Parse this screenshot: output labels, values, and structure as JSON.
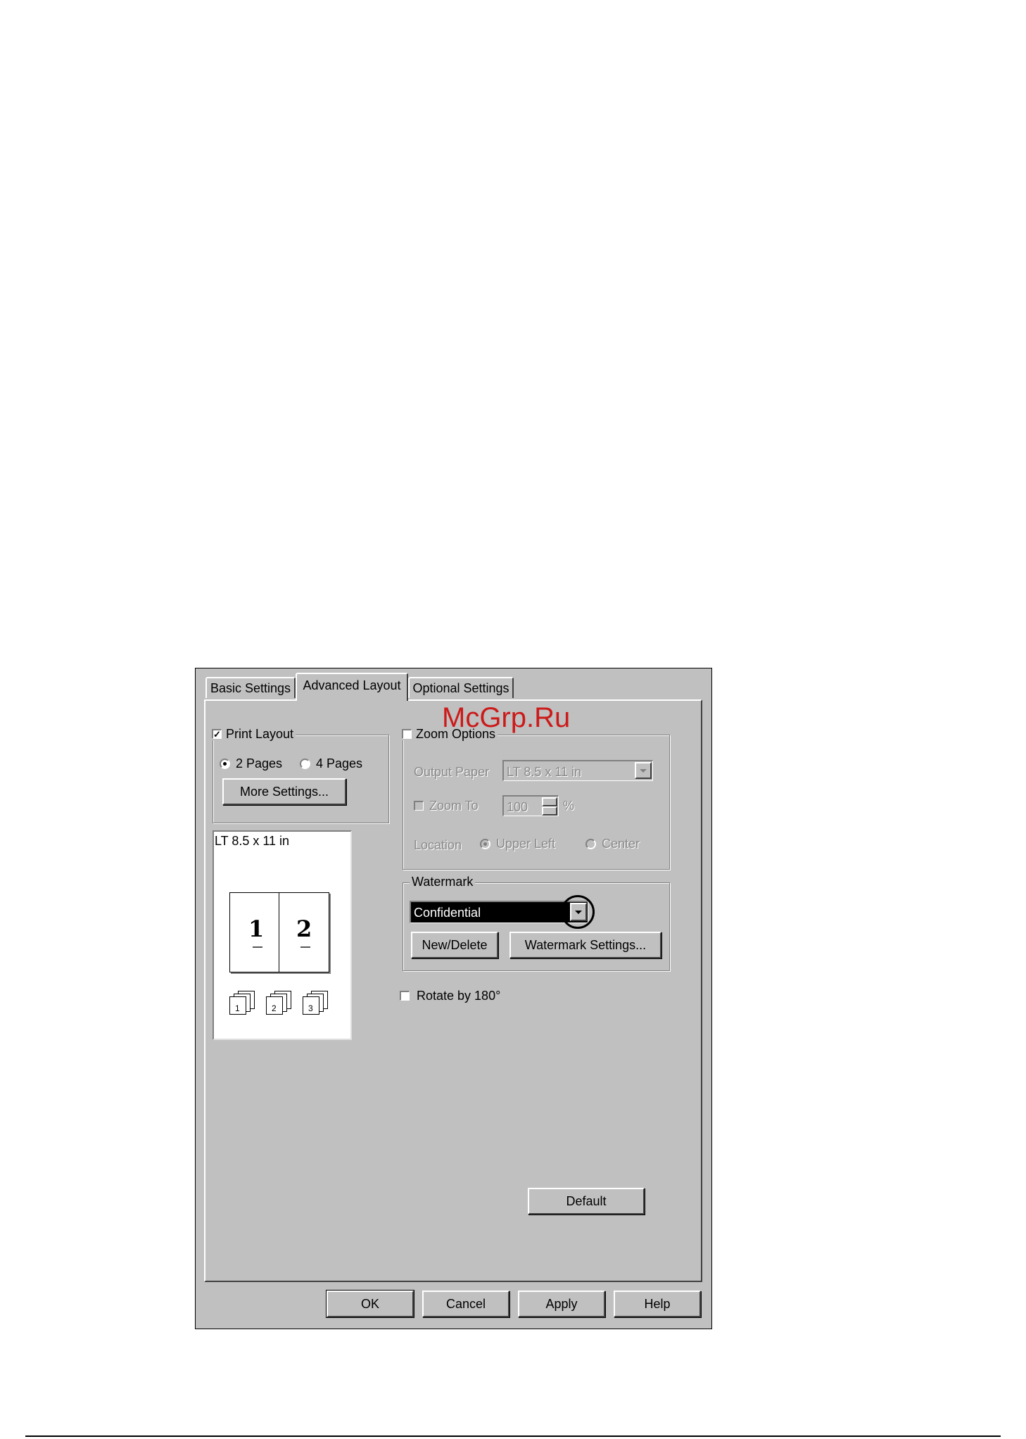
{
  "watermark_brand": "McGrp.Ru",
  "tabs": [
    {
      "label": "Basic Settings"
    },
    {
      "label": "Advanced Layout"
    },
    {
      "label": "Optional Settings"
    }
  ],
  "active_tab": "Advanced Layout",
  "print_layout": {
    "label": "Print Layout",
    "checked": true,
    "option_2pages": "2 Pages",
    "option_4pages": "4 Pages",
    "selected": "2 Pages",
    "more_settings": "More Settings..."
  },
  "preview": {
    "paper_label": "LT 8.5 x 11 in",
    "page1": "1",
    "page2": "2",
    "order_icons": [
      "1",
      "2",
      "3"
    ]
  },
  "zoom_options": {
    "label": "Zoom Options",
    "checked": false,
    "output_paper_label": "Output Paper",
    "output_paper_value": "LT 8.5 x 11 in",
    "zoom_to_label": "Zoom To",
    "zoom_to_value": "100",
    "percent_sign": "%",
    "location_label": "Location",
    "upper_left": "Upper Left",
    "center": "Center",
    "location_selected": "Upper Left"
  },
  "watermark": {
    "label": "Watermark",
    "selected_value": "Confidential",
    "new_delete": "New/Delete",
    "settings": "Watermark Settings..."
  },
  "rotate": {
    "label": "Rotate by 180°",
    "checked": false
  },
  "buttons": {
    "default": "Default",
    "ok": "OK",
    "cancel": "Cancel",
    "apply": "Apply",
    "help": "Help"
  },
  "colors": {
    "dialog_bg": "#c0c0c0",
    "brand_red": "#cc1a1a",
    "selection_bg": "#000000"
  }
}
